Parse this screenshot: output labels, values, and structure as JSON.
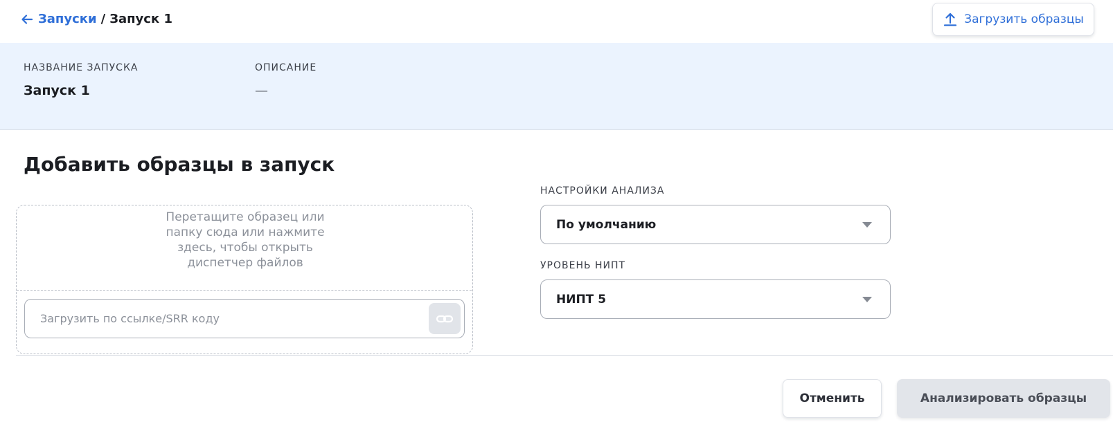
{
  "header": {
    "breadcrumb_link": "Запуски",
    "breadcrumb_separator": "/",
    "breadcrumb_current": "Запуск 1",
    "upload_button_label": "Загрузить образцы"
  },
  "run_info": {
    "name_label": "НАЗВАНИЕ ЗАПУСКА",
    "name_value": "Запуск 1",
    "description_label": "ОПИСАНИЕ",
    "description_value": "—"
  },
  "add_samples": {
    "title": "Добавить образцы в запуск",
    "dropzone_text": "Перетащите образец или папку сюда или нажмите здесь, чтобы открыть диспетчер файлов",
    "link_input_placeholder": "Загрузить по ссылке/SRR коду",
    "link_input_value": ""
  },
  "settings": {
    "analysis_label": "НАСТРОЙКИ АНАЛИЗА",
    "analysis_value": "По умолчанию",
    "nipt_label": "УРОВЕНЬ НИПТ",
    "nipt_value": "НИПТ 5"
  },
  "footer": {
    "cancel_label": "Отменить",
    "analyze_label": "Анализировать образцы"
  },
  "icons": {
    "back": "arrow-left-icon",
    "upload": "upload-icon",
    "link": "link-icon",
    "caret": "chevron-down-icon"
  },
  "colors": {
    "accent": "#2f6fd8",
    "info_band_bg": "#ebf3fe",
    "disabled_button_bg": "#e2e5ea"
  }
}
